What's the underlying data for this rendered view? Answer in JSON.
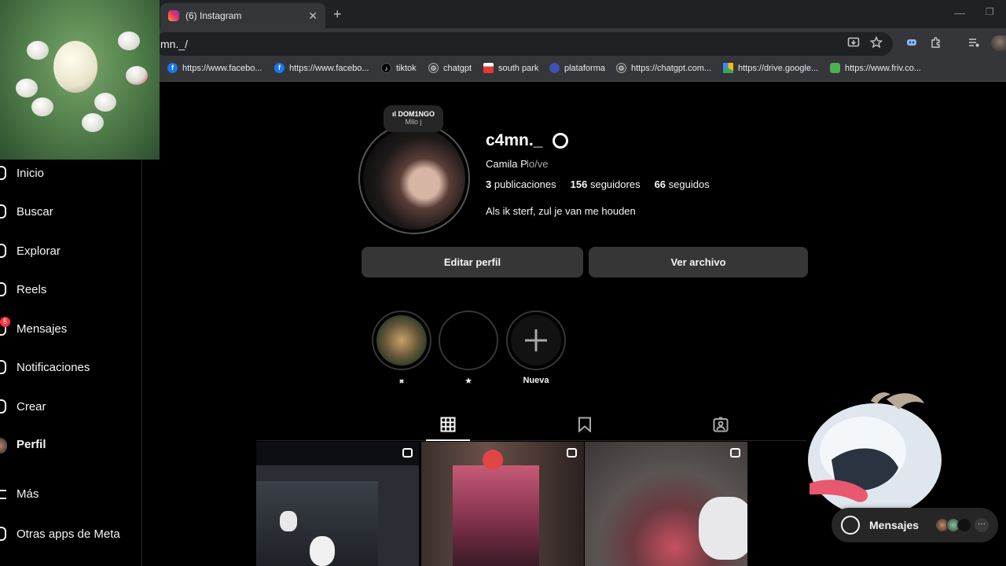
{
  "browser": {
    "tab_title": "(6) Instagram",
    "tab_close": "✕",
    "new_tab": "+",
    "address": "mn._/",
    "minimize": "—",
    "maximize": "❐",
    "bookmarks": [
      {
        "label": "https://www.facebo...",
        "icon": "facebook-icon",
        "color": "#1877f2"
      },
      {
        "label": "https://www.facebo...",
        "icon": "facebook-icon",
        "color": "#1877f2"
      },
      {
        "label": "tiktok",
        "icon": "tiktok-icon",
        "color": "#000000"
      },
      {
        "label": "chatgpt",
        "icon": "chatgpt-icon",
        "color": "#444444"
      },
      {
        "label": "south park",
        "icon": "flag-icon",
        "color": "#e53935"
      },
      {
        "label": "plataforma",
        "icon": "plataforma-icon",
        "color": "#3f51b5"
      },
      {
        "label": "https://chatgpt.com...",
        "icon": "chatgpt-icon",
        "color": "#444444"
      },
      {
        "label": "https://drive.google...",
        "icon": "google-drive-icon",
        "color": "#fbbc04"
      },
      {
        "label": "https://www.friv.co...",
        "icon": "friv-icon",
        "color": "#4caf50"
      }
    ]
  },
  "sidebar": {
    "items": [
      {
        "label": "Inicio",
        "icon": "home-icon"
      },
      {
        "label": "Buscar",
        "icon": "search-icon"
      },
      {
        "label": "Explorar",
        "icon": "compass-icon"
      },
      {
        "label": "Reels",
        "icon": "reels-icon"
      },
      {
        "label": "Mensajes",
        "icon": "messenger-icon"
      },
      {
        "label": "Notificaciones",
        "icon": "heart-icon"
      },
      {
        "label": "Crear",
        "icon": "create-icon"
      },
      {
        "label": "Perfil",
        "icon": "avatar"
      },
      {
        "label": "Más",
        "icon": "menu-icon"
      },
      {
        "label": "Otras apps de Meta",
        "icon": "meta-apps-icon"
      }
    ],
    "messages_badge": "5"
  },
  "profile": {
    "note_title": "DOM1NGO",
    "note_subtitle": "Milo j",
    "username": "c4mn._",
    "full_name": "Camila P",
    "pronouns": "lo/ve",
    "posts_count": "3",
    "posts_label": "publicaciones",
    "followers_count": "156",
    "followers_label": "seguidores",
    "following_count": "66",
    "following_label": "seguidos",
    "bio": "Als ik sterf, zul je van me houden",
    "edit_button": "Editar perfil",
    "archive_button": "Ver archivo"
  },
  "highlights": [
    {
      "label": "𝄪"
    },
    {
      "label": "★"
    },
    {
      "label": "Nueva"
    }
  ],
  "tabs": [
    {
      "name": "posts",
      "icon": "grid-icon",
      "active": true
    },
    {
      "name": "saved",
      "icon": "bookmark-icon",
      "active": false
    },
    {
      "name": "tagged",
      "icon": "tagged-icon",
      "active": false
    }
  ],
  "messages_bar": {
    "label": "Mensajes",
    "more": "···"
  }
}
